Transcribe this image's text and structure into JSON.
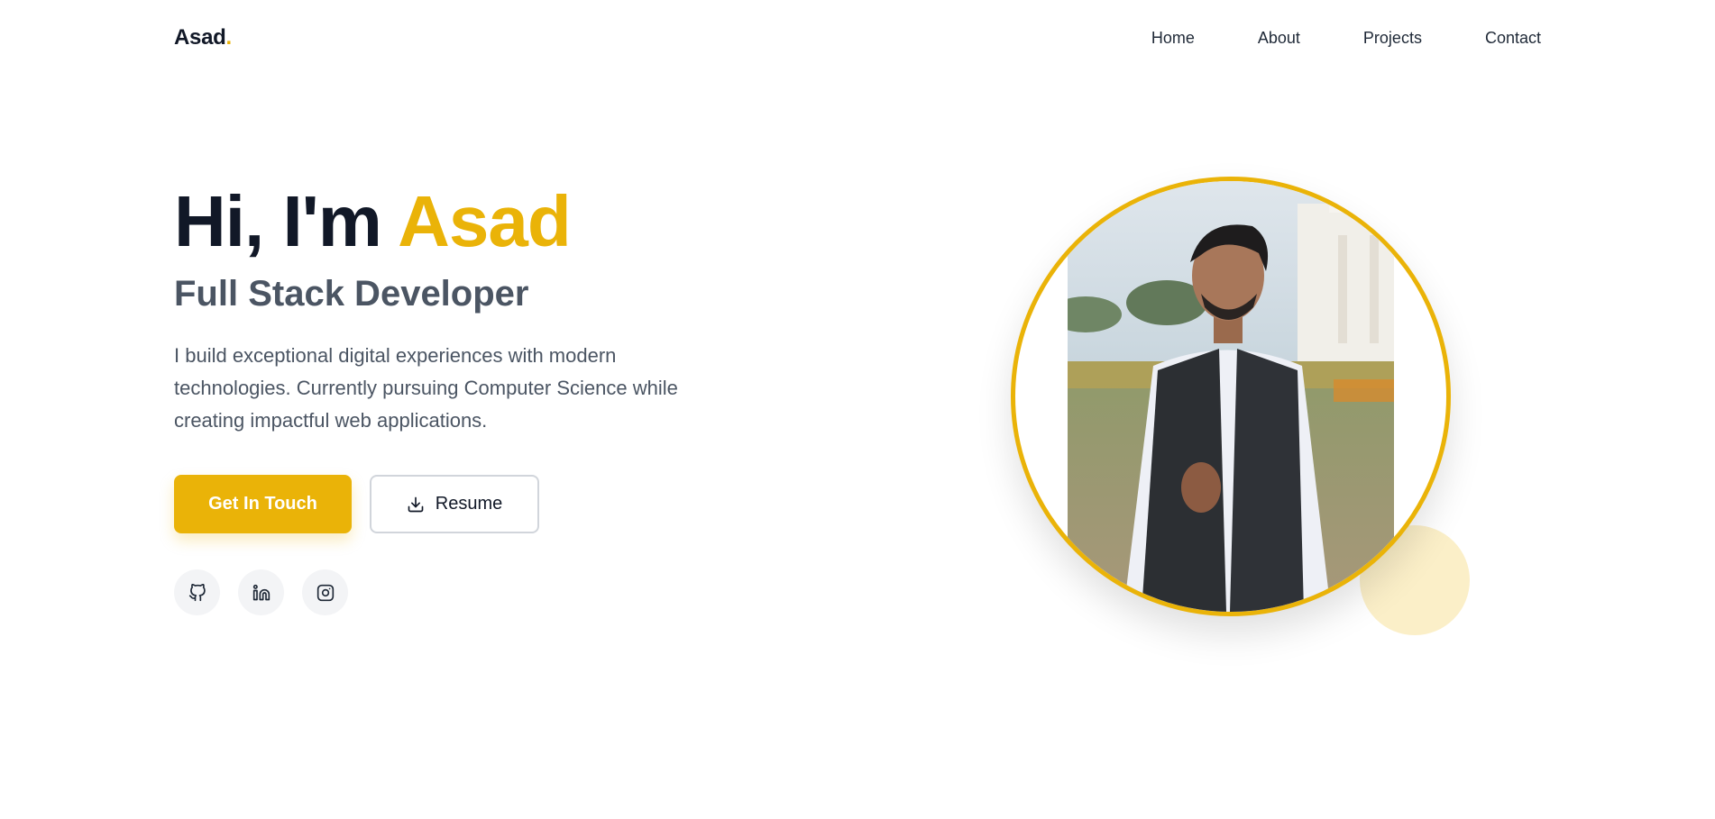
{
  "nav": {
    "logo_text": "Asad",
    "logo_dot": ".",
    "links": [
      "Home",
      "About",
      "Projects",
      "Contact"
    ]
  },
  "hero": {
    "greeting": "Hi, I'm ",
    "name": "Asad",
    "subtitle": "Full Stack Developer",
    "description": "I build exceptional digital experiences with modern technologies. Currently pursuing Computer Science while creating impactful web applications.",
    "primary_button": "Get In Touch",
    "secondary_button": "Resume",
    "socials": [
      "github-icon",
      "linkedin-icon",
      "instagram-icon"
    ]
  },
  "colors": {
    "accent": "#eab308",
    "heading": "#111827",
    "body_text": "#4b5563",
    "deco_circle": "#fbefc8"
  }
}
